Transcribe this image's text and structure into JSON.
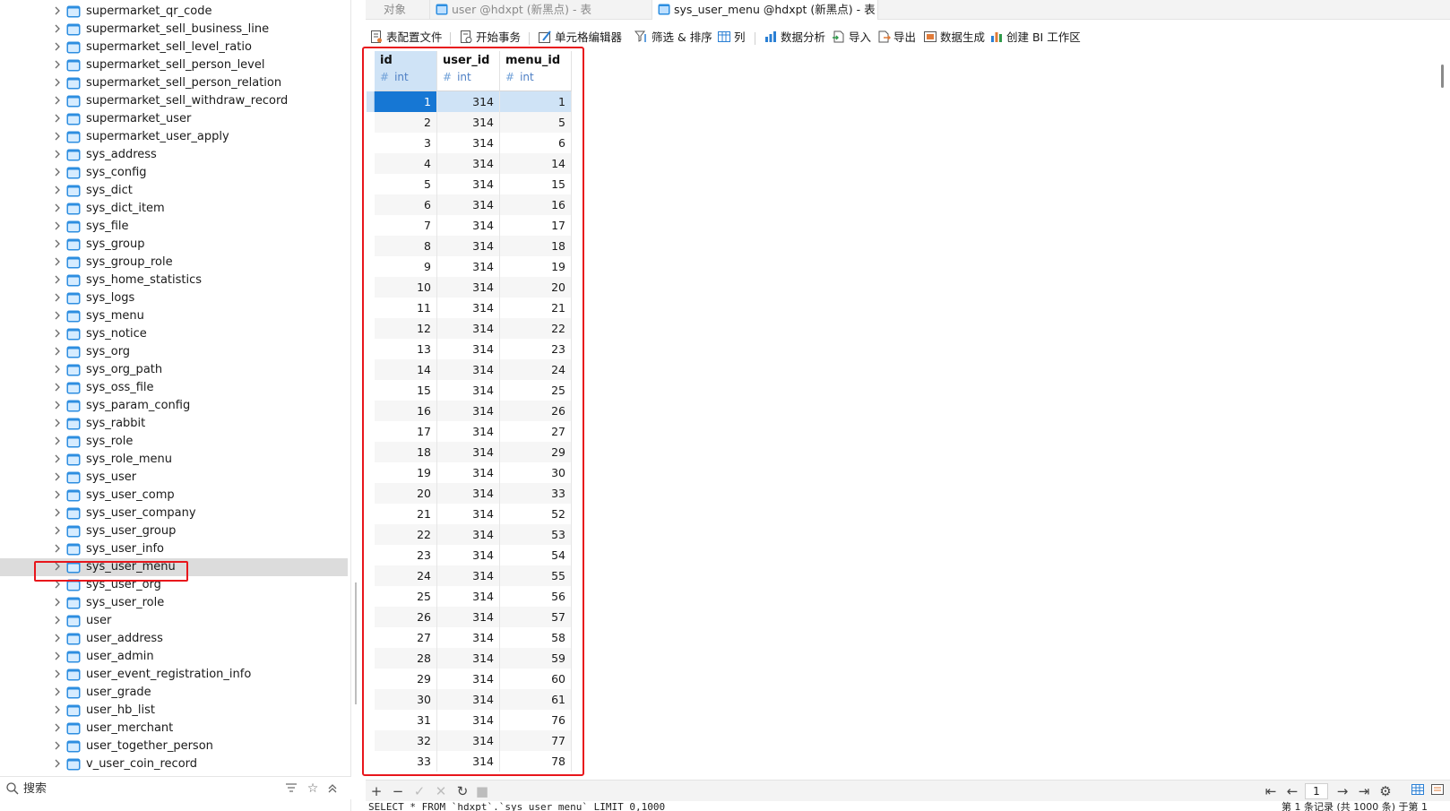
{
  "colors": {
    "accent": "#1677d4",
    "selection": "#cfe3f6",
    "highlight_box": "#e8161c",
    "table_icon": "#2d8ee0"
  },
  "navigator": {
    "items": [
      {
        "label": "supermarket_qr_code",
        "icon": "table-icon"
      },
      {
        "label": "supermarket_sell_business_line",
        "icon": "table-icon"
      },
      {
        "label": "supermarket_sell_level_ratio",
        "icon": "table-icon"
      },
      {
        "label": "supermarket_sell_person_level",
        "icon": "table-icon"
      },
      {
        "label": "supermarket_sell_person_relation",
        "icon": "table-icon"
      },
      {
        "label": "supermarket_sell_withdraw_record",
        "icon": "table-icon"
      },
      {
        "label": "supermarket_user",
        "icon": "table-icon"
      },
      {
        "label": "supermarket_user_apply",
        "icon": "table-icon"
      },
      {
        "label": "sys_address",
        "icon": "table-icon"
      },
      {
        "label": "sys_config",
        "icon": "table-icon"
      },
      {
        "label": "sys_dict",
        "icon": "table-icon"
      },
      {
        "label": "sys_dict_item",
        "icon": "table-icon"
      },
      {
        "label": "sys_file",
        "icon": "table-icon"
      },
      {
        "label": "sys_group",
        "icon": "table-icon"
      },
      {
        "label": "sys_group_role",
        "icon": "table-icon"
      },
      {
        "label": "sys_home_statistics",
        "icon": "table-icon"
      },
      {
        "label": "sys_logs",
        "icon": "table-icon"
      },
      {
        "label": "sys_menu",
        "icon": "table-icon"
      },
      {
        "label": "sys_notice",
        "icon": "table-icon"
      },
      {
        "label": "sys_org",
        "icon": "table-icon"
      },
      {
        "label": "sys_org_path",
        "icon": "table-icon"
      },
      {
        "label": "sys_oss_file",
        "icon": "table-icon"
      },
      {
        "label": "sys_param_config",
        "icon": "table-icon"
      },
      {
        "label": "sys_rabbit",
        "icon": "table-icon"
      },
      {
        "label": "sys_role",
        "icon": "table-icon"
      },
      {
        "label": "sys_role_menu",
        "icon": "table-icon"
      },
      {
        "label": "sys_user",
        "icon": "table-icon"
      },
      {
        "label": "sys_user_comp",
        "icon": "table-icon"
      },
      {
        "label": "sys_user_company",
        "icon": "table-icon"
      },
      {
        "label": "sys_user_group",
        "icon": "table-icon"
      },
      {
        "label": "sys_user_info",
        "icon": "table-icon"
      },
      {
        "label": "sys_user_menu",
        "icon": "table-icon",
        "selected": true
      },
      {
        "label": "sys_user_org",
        "icon": "table-icon"
      },
      {
        "label": "sys_user_role",
        "icon": "table-icon"
      },
      {
        "label": "user",
        "icon": "table-icon"
      },
      {
        "label": "user_address",
        "icon": "table-icon"
      },
      {
        "label": "user_admin",
        "icon": "table-icon"
      },
      {
        "label": "user_event_registration_info",
        "icon": "table-icon"
      },
      {
        "label": "user_grade",
        "icon": "table-icon"
      },
      {
        "label": "user_hb_list",
        "icon": "table-icon"
      },
      {
        "label": "user_merchant",
        "icon": "table-icon"
      },
      {
        "label": "user_together_person",
        "icon": "table-icon"
      },
      {
        "label": "v_user_coin_record",
        "icon": "table-icon"
      }
    ],
    "search": {
      "placeholder": "搜索"
    }
  },
  "tabs": [
    {
      "label": "对象",
      "icon": null
    },
    {
      "label": "user @hdxpt (新黑点) - 表",
      "icon": "table-icon"
    },
    {
      "label": "sys_user_menu @hdxpt (新黑点) - 表",
      "icon": "table-icon",
      "active": true
    }
  ],
  "toolbar": [
    {
      "label": "表配置文件",
      "icon": "profile-icon"
    },
    {
      "label": "开始事务",
      "icon": "transaction-icon"
    },
    {
      "label": "单元格编辑器",
      "icon": "cell-editor-icon"
    },
    {
      "label": "筛选 & 排序",
      "icon": "filter-sort-icon"
    },
    {
      "label": "列",
      "icon": "columns-icon"
    },
    {
      "label": "数据分析",
      "icon": "data-analysis-icon"
    },
    {
      "label": "导入",
      "icon": "import-icon"
    },
    {
      "label": "导出",
      "icon": "export-icon"
    },
    {
      "label": "数据生成",
      "icon": "data-generation-icon"
    },
    {
      "label": "创建 BI 工作区",
      "icon": "bi-workspace-icon"
    }
  ],
  "grid": {
    "columns": [
      {
        "name": "id",
        "type": "int",
        "type_icon": "#"
      },
      {
        "name": "user_id",
        "type": "int",
        "type_icon": "#"
      },
      {
        "name": "menu_id",
        "type": "int",
        "type_icon": "#"
      }
    ],
    "rows": [
      [
        "1",
        "314",
        "1"
      ],
      [
        "2",
        "314",
        "5"
      ],
      [
        "3",
        "314",
        "6"
      ],
      [
        "4",
        "314",
        "14"
      ],
      [
        "5",
        "314",
        "15"
      ],
      [
        "6",
        "314",
        "16"
      ],
      [
        "7",
        "314",
        "17"
      ],
      [
        "8",
        "314",
        "18"
      ],
      [
        "9",
        "314",
        "19"
      ],
      [
        "10",
        "314",
        "20"
      ],
      [
        "11",
        "314",
        "21"
      ],
      [
        "12",
        "314",
        "22"
      ],
      [
        "13",
        "314",
        "23"
      ],
      [
        "14",
        "314",
        "24"
      ],
      [
        "15",
        "314",
        "25"
      ],
      [
        "16",
        "314",
        "26"
      ],
      [
        "17",
        "314",
        "27"
      ],
      [
        "18",
        "314",
        "29"
      ],
      [
        "19",
        "314",
        "30"
      ],
      [
        "20",
        "314",
        "33"
      ],
      [
        "21",
        "314",
        "52"
      ],
      [
        "22",
        "314",
        "53"
      ],
      [
        "23",
        "314",
        "54"
      ],
      [
        "24",
        "314",
        "55"
      ],
      [
        "25",
        "314",
        "56"
      ],
      [
        "26",
        "314",
        "57"
      ],
      [
        "27",
        "314",
        "58"
      ],
      [
        "28",
        "314",
        "59"
      ],
      [
        "29",
        "314",
        "60"
      ],
      [
        "30",
        "314",
        "61"
      ],
      [
        "31",
        "314",
        "76"
      ],
      [
        "32",
        "314",
        "77"
      ],
      [
        "33",
        "314",
        "78"
      ]
    ]
  },
  "bottombar": {
    "page": "1"
  },
  "status": {
    "sql": "SELECT * FROM `hdxpt`.`sys_user_menu` LIMIT 0,1000",
    "records": "第 1 条记录 (共 1000 条) 于第 1"
  }
}
